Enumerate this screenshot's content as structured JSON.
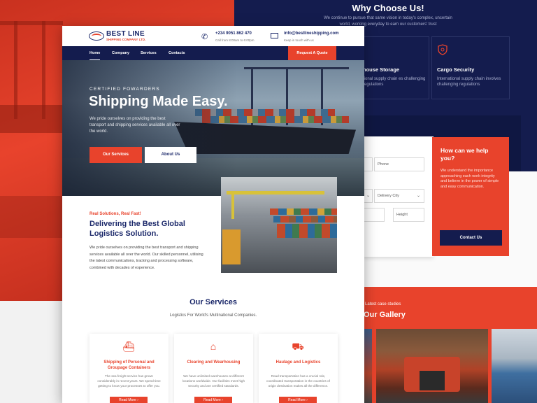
{
  "why": {
    "title": "Why Choose Us!",
    "subtitle": "We continue to pursue that same vision in today's complex, uncertain world, working everyday to earn our customers' trust",
    "cards": [
      {
        "title": "house Storage",
        "desc": "tional supply chain es challenging regulations"
      },
      {
        "title": "Cargo Security",
        "desc": "International supply chain involves challenging regulations"
      }
    ]
  },
  "form": {
    "phone_placeholder": "Phone",
    "city_placeholder": "Delivery City",
    "height_placeholder": "Height"
  },
  "help": {
    "title": "How can we  help you?",
    "desc": "We understand the importance approaching each work integrity and believe in the power of simple and easy communication.",
    "button": "Contact Us"
  },
  "gallery": {
    "kicker": "Latest case studies",
    "title": "Our Gallery"
  },
  "header": {
    "logo_title": "BEST LINE",
    "logo_sub": "SHIPPING COMPANY LTD.",
    "phone": "+234 9051 862 470",
    "phone_note": "Call from 8:00am to 6:00pm",
    "email": "info@bestlineshipping.com",
    "email_note": "Keep in touch with us"
  },
  "nav": {
    "items": [
      "Home",
      "Company",
      "Services",
      "Contacts"
    ],
    "quote": "Request A Quote"
  },
  "hero": {
    "kicker": "CERTIFIED FOWARDERS",
    "title": "Shipping Made Easy.",
    "desc": "We pride ourselves on providing the best transport and shipping services available all over the world.",
    "btn_primary": "Our Services",
    "btn_secondary": "About Us"
  },
  "about": {
    "kicker": "Real Solutions, Real Fast!",
    "title": "Delivering the Best Global Logistics Solution.",
    "desc": "We pride ourselves on providing the best transport and shipping services available all over the world. Our skilled personnel, utilising the latest communications, tracking and processing software, combined with decades of experience."
  },
  "services": {
    "title": "Our Services",
    "subtitle": "Logistics For World's Multinational Companies.",
    "read_more": "Read More",
    "items": [
      {
        "icon": "ship-icon",
        "title": "Shipping of Personal and Groupage Containers",
        "desc": "The sea freight service has grown considerably in recent years. We spend time getting to know your processes to offer you."
      },
      {
        "icon": "warehouse-icon",
        "title": "Clearing and Wearhousing",
        "desc": "We have unlimited warehouses at different locations worldwide. Our facilities meet high security and are certified standards."
      },
      {
        "icon": "truck-icon",
        "title": "Haulage and Logistics",
        "desc": "Road transportation has a crucial role, coordinated transportation in the countries of origin destination makes all the difference."
      }
    ]
  },
  "colors": {
    "accent": "#e8432c",
    "navy": "#141c4e"
  }
}
